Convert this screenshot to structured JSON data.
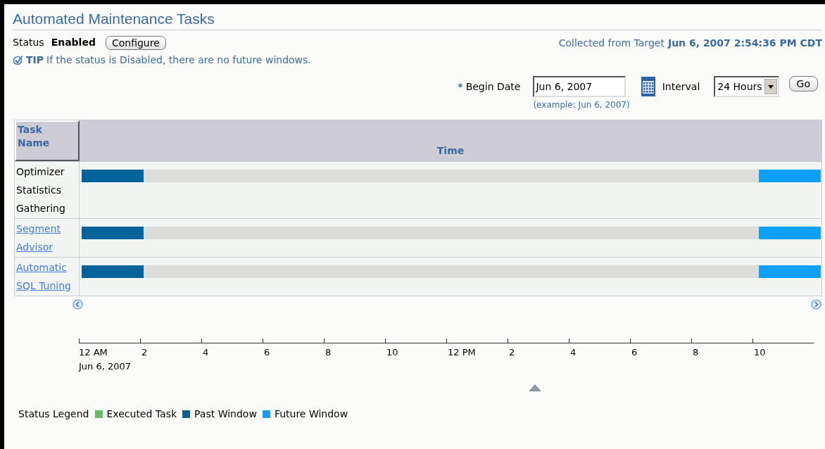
{
  "title": "Automated Maintenance Tasks",
  "status": {
    "label": "Status",
    "value": "Enabled"
  },
  "configure_button": "Configure",
  "tip": {
    "label": "TIP",
    "text": "If the status is Disabled, there are no future windows."
  },
  "collected": {
    "label": "Collected from Target",
    "value": "Jun 6, 2007 2:54:36 PM CDT"
  },
  "begin_date": {
    "required_mark": "*",
    "label": "Begin Date",
    "value": "Jun 6, 2007",
    "hint": "(example: Jun 6, 2007)"
  },
  "interval": {
    "label": "Interval",
    "value": "24 Hours"
  },
  "go_button": "Go",
  "table": {
    "columns": [
      "Task Name",
      "Time"
    ],
    "rows": [
      {
        "name": "Optimizer Statistics Gathering",
        "link": false,
        "past_window": {
          "level": 0.084
        },
        "future_window": {
          "level": 0.084
        }
      },
      {
        "name": "Segment Advisor",
        "link": true,
        "past_window": {
          "level": 0.084
        },
        "future_window": {
          "level": 0.084
        }
      },
      {
        "name": "Automatic SQL Tuning",
        "link": true,
        "past_window": {
          "level": 0.084
        },
        "future_window": {
          "level": 0.084
        }
      }
    ]
  },
  "axis": {
    "ticks": [
      "12 AM",
      "2",
      "4",
      "6",
      "8",
      "10",
      "12 PM",
      "2",
      "4",
      "6",
      "8",
      "10"
    ],
    "date": "Jun 6, 2007"
  },
  "legend": {
    "label": "Status Legend",
    "items": [
      {
        "label": "Executed Task",
        "color": "#66bb66"
      },
      {
        "label": "Past Window",
        "color": "#0b5f94"
      },
      {
        "label": "Future Window",
        "color": "#1a9cf5"
      }
    ]
  }
}
